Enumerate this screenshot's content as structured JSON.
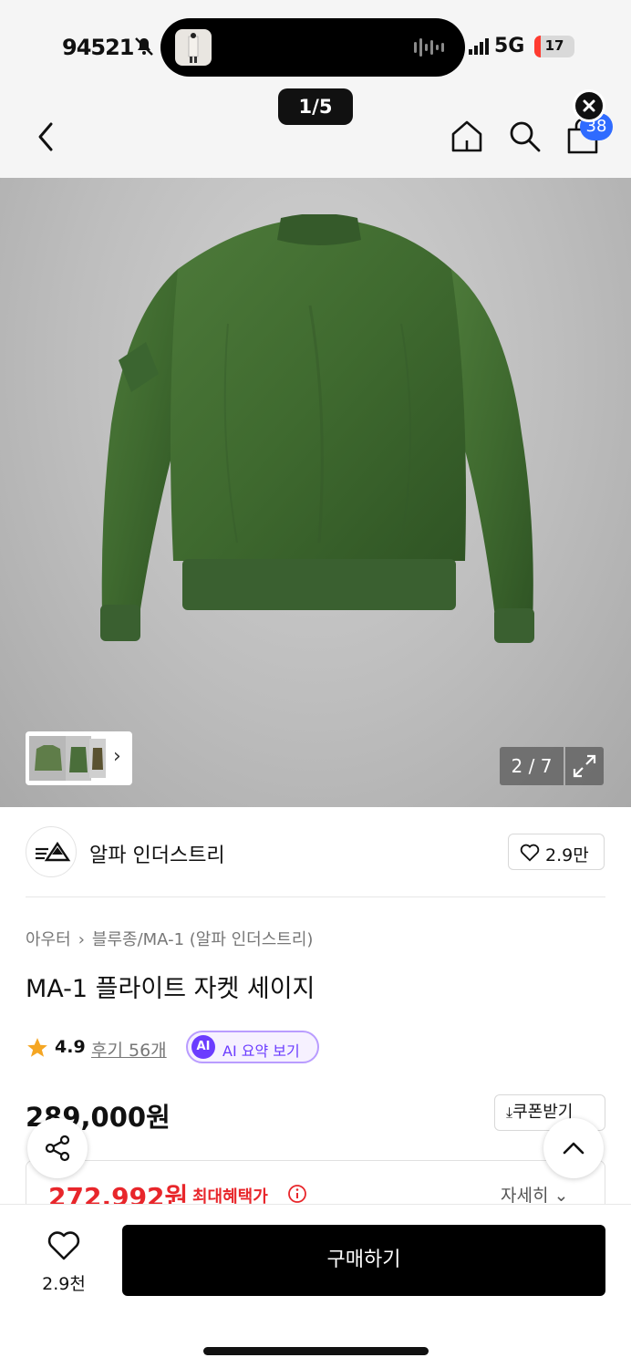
{
  "status_bar": {
    "time": "94521",
    "signal_text": "5G",
    "battery": "17",
    "battery_level_percent": 17
  },
  "header": {
    "image_page": "1/5",
    "cart_count": "38"
  },
  "gallery": {
    "counter": "2 / 7"
  },
  "brand": {
    "name": "알파 인더스트리",
    "likes": "2.9만"
  },
  "breadcrumb": {
    "category": "아우터",
    "sub_category": "블루종/MA-1 (알파 인더스트리)"
  },
  "product": {
    "title": "MA-1 플라이트 자켓 세이지",
    "rating": "4.9",
    "reviews": "후기 56개",
    "ai_badge": "AI",
    "ai_summary": "AI 요약 보기",
    "price": "289,000원",
    "coupon_label": "쿠폰받기",
    "sale_price": "272,992원",
    "max_benefit_label": "최대혜택가",
    "detail_label": "자세히"
  },
  "bottom_bar": {
    "wish_count": "2.9천",
    "buy_label": "구매하기"
  },
  "colors": {
    "accent_red": "#e8262b",
    "ai_purple": "#6b3cff",
    "cart_blue": "#2f6bff",
    "jacket_green": "#3f6a2f"
  }
}
